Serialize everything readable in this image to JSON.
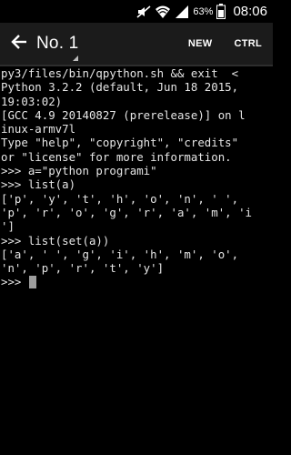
{
  "status_bar": {
    "battery_percent": "63%",
    "time": "08:06",
    "icons": [
      "mute-icon",
      "wifi-icon",
      "signal-icon",
      "battery-icon"
    ]
  },
  "action_bar": {
    "title": "No. 1",
    "back_icon": "arrow-back-icon",
    "new_label": "NEW",
    "ctrl_label": "CTRL"
  },
  "terminal": {
    "lines": [
      "py3/files/bin/qpython.sh && exit  <",
      "Python 3.2.2 (default, Jun 18 2015,",
      "19:03:02)",
      "[GCC 4.9 20140827 (prerelease)] on l",
      "inux-armv7l",
      "Type \"help\", \"copyright\", \"credits\"",
      "or \"license\" for more information.",
      ">>> a=\"python programi\"",
      ">>> list(a)",
      "['p', 'y', 't', 'h', 'o', 'n', ' ',",
      "'p', 'r', 'o', 'g', 'r', 'a', 'm', 'i",
      "']",
      ">>> list(set(a))",
      "['a', ' ', 'g', 'i', 'h', 'm', 'o',",
      "'n', 'p', 'r', 't', 'y']"
    ],
    "prompt": ">>> "
  }
}
